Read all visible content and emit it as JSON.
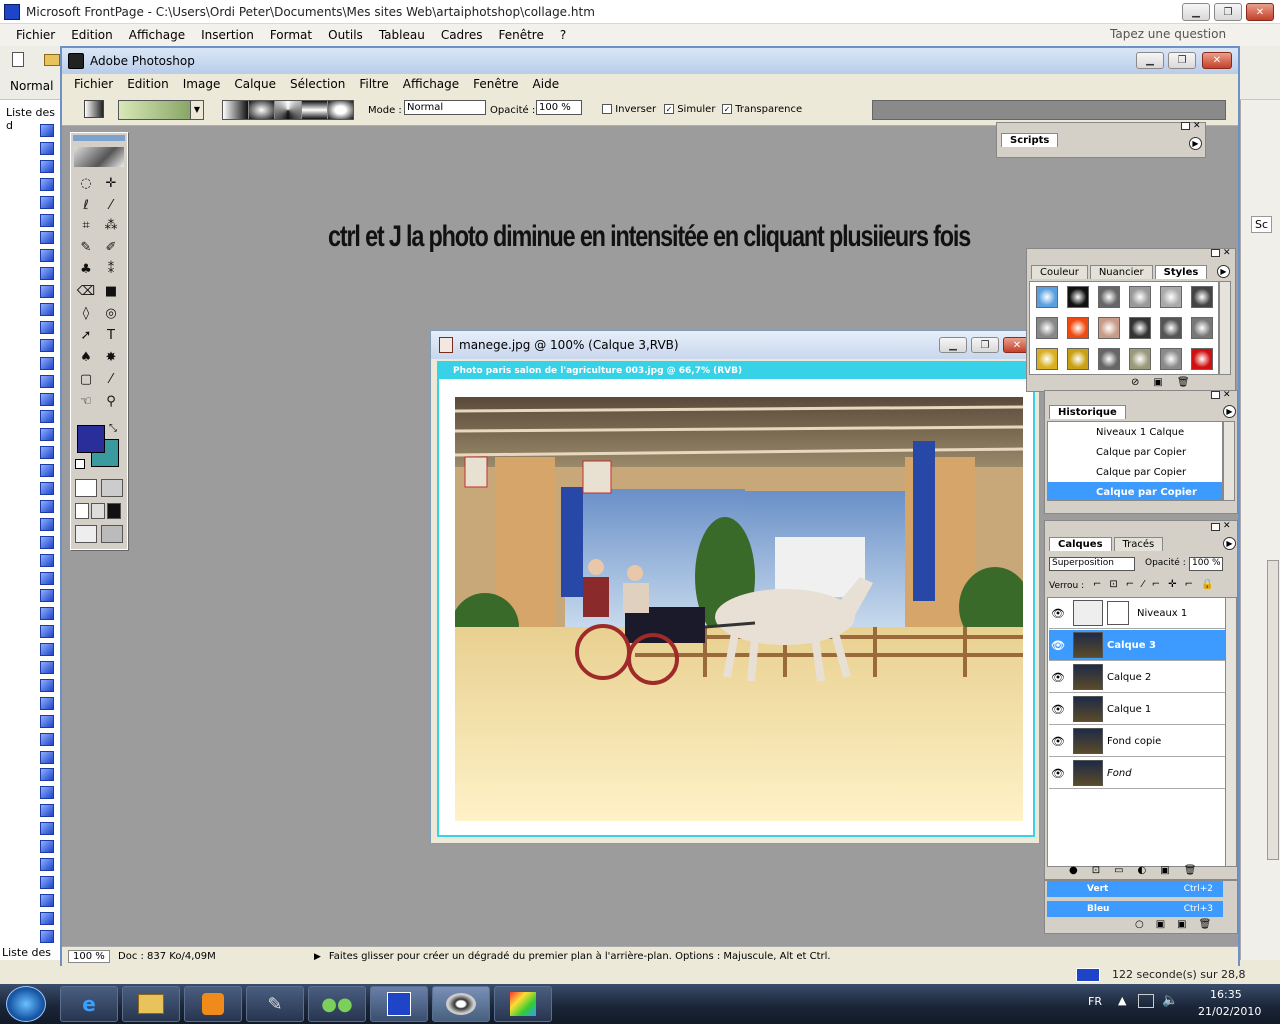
{
  "frontpage": {
    "title": "Microsoft FrontPage - C:\\Users\\Ordi Peter\\Documents\\Mes sites Web\\artaiphotshop\\collage.htm",
    "menu": [
      "Fichier",
      "Edition",
      "Affichage",
      "Insertion",
      "Format",
      "Outils",
      "Tableau",
      "Cadres",
      "Fenêtre",
      "?"
    ],
    "help_placeholder": "Tapez une question",
    "style_value": "Normal",
    "left_panel_label": "Liste des d",
    "bottom_left_label": "Liste des",
    "right_edge_label": "Sc",
    "status_fragment": "122 seconde(s) sur 28,8"
  },
  "photoshop": {
    "title": "Adobe Photoshop",
    "menu": [
      "Fichier",
      "Edition",
      "Image",
      "Calque",
      "Sélection",
      "Filtre",
      "Affichage",
      "Fenêtre",
      "Aide"
    ],
    "options": {
      "mode_label": "Mode :",
      "mode_value": "Normal",
      "opacity_label": "Opacité :",
      "opacity_value": "100 %",
      "inverser": "Inverser",
      "simuler": "Simuler",
      "transparence": "Transparence"
    },
    "canvas_message": "ctrl et J  la photo diminue en intensitée en cliquant plusiieurs fois",
    "colors": {
      "foreground": "#2a2e9a",
      "background": "#3a9aa0",
      "accent": "#3d9bff"
    },
    "status": {
      "zoom": "100 %",
      "doc": "Doc : 837 Ko/4,09M",
      "hint": "Faites glisser pour créer un dégradé du premier plan à l'arrière-plan. Options : Majuscule, Alt et Ctrl."
    }
  },
  "image_window": {
    "title": "manege.jpg @ 100% (Calque  3,RVB)",
    "behind_title": "Photo paris salon de l'agriculture 003.jpg @ 66,7% (RVB)"
  },
  "scripts_panel": {
    "tab": "Scripts"
  },
  "styles_panel": {
    "tabs": [
      "Couleur",
      "Nuancier",
      "Styles"
    ]
  },
  "history_panel": {
    "tab": "Historique",
    "items": [
      "Niveaux 1 Calque",
      "Calque par Copier",
      "Calque par Copier",
      "Calque par Copier"
    ]
  },
  "layers_panel": {
    "tabs": [
      "Calques",
      "Tracés"
    ],
    "blend": "Superposition",
    "opacity_label": "Opacité :",
    "opacity": "100 %",
    "lock_label": "Verrou :",
    "layers": [
      "Niveaux 1",
      "Calque  3",
      "Calque  2",
      "Calque  1",
      "Fond copie",
      "Fond"
    ],
    "channels": [
      "Vert",
      "Bleu"
    ],
    "channel_shortcuts": [
      "Ctrl+2",
      "Ctrl+3"
    ]
  },
  "taskbar": {
    "lang": "FR",
    "time": "16:35",
    "date": "21/02/2010"
  }
}
